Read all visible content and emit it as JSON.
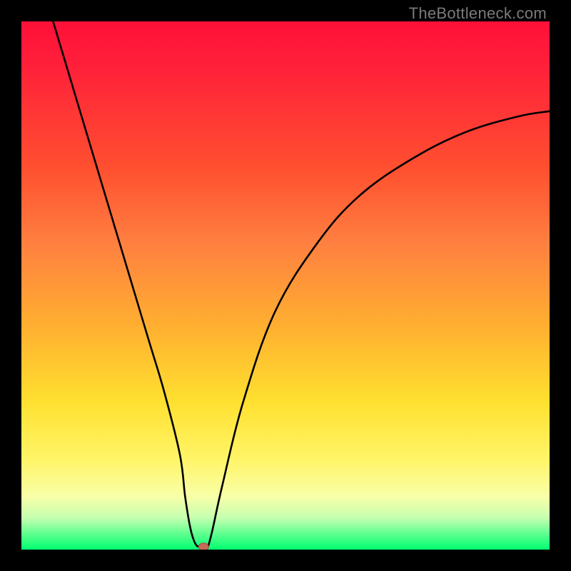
{
  "watermark": "TheBottleneck.com",
  "colors": {
    "background": "#000000",
    "gradient_top": "#ff1038",
    "gradient_bottom": "#00ff70",
    "curve": "#000000",
    "dot": "#c76a5a"
  },
  "chart_data": {
    "type": "line",
    "title": "",
    "xlabel": "",
    "ylabel": "",
    "xlim": [
      0,
      100
    ],
    "ylim": [
      0,
      100
    ],
    "grid": false,
    "legend": false,
    "series": [
      {
        "name": "curve",
        "x": [
          6,
          12,
          18,
          24,
          27,
          30,
          31,
          32,
          33,
          34,
          35,
          36,
          38,
          42,
          48,
          56,
          64,
          74,
          84,
          94,
          100
        ],
        "y": [
          100,
          80,
          60,
          40,
          30,
          18,
          10,
          4,
          1,
          0.5,
          0,
          3,
          12,
          28,
          45,
          58,
          67,
          74,
          79,
          82,
          83
        ]
      }
    ],
    "marker": {
      "x": 34.5,
      "y": 0.5
    }
  }
}
